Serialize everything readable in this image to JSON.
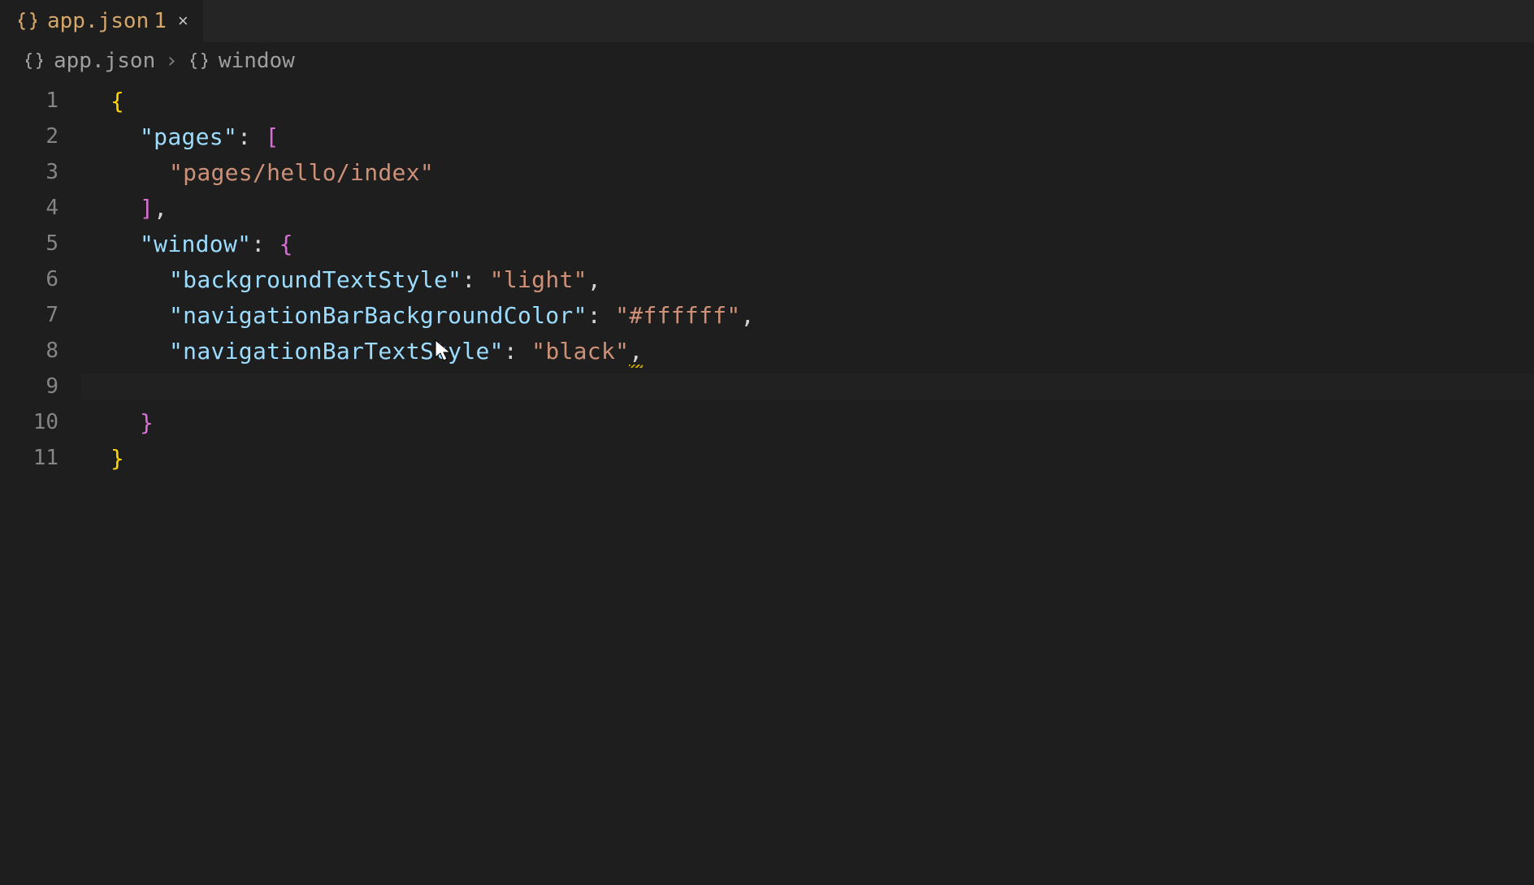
{
  "tab": {
    "filename": "app.json",
    "modified_badge": "1",
    "close_glyph": "×"
  },
  "breadcrumb": {
    "file": "app.json",
    "separator": "›",
    "node": "window"
  },
  "editor": {
    "lines": [
      "1",
      "2",
      "3",
      "4",
      "5",
      "6",
      "7",
      "8",
      "9",
      "10",
      "11"
    ],
    "tokens": {
      "obrace": "{",
      "cbrace": "}",
      "obracket": "[",
      "cbracket": "]",
      "comma": ",",
      "colon": ":",
      "q": "\"",
      "key_pages": "pages",
      "str_pages_index": "pages/hello/index",
      "key_window": "window",
      "key_bgTextStyle": "backgroundTextStyle",
      "val_light": "light",
      "key_navBg": "navigationBarBackgroundColor",
      "val_ffffff": "#ffffff",
      "key_navText": "navigationBarTextStyle",
      "val_black": "black"
    }
  }
}
